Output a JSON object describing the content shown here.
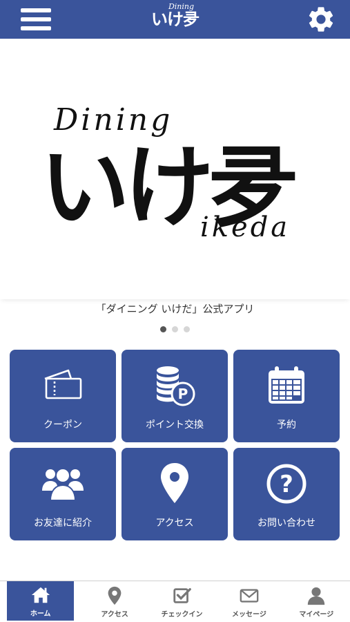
{
  "header": {
    "logo_small": "Dining",
    "logo_big": "いけ夛",
    "menu_icon": "hamburger-icon",
    "settings_icon": "gear-icon"
  },
  "hero": {
    "dining": "Dining",
    "main": "いけ夛",
    "ikeda": "ikeda"
  },
  "caption": "「ダイニング いけだ」公式アプリ",
  "carousel": {
    "count": 3,
    "active": 0
  },
  "menu": [
    {
      "label": "クーポン",
      "icon": "ticket-icon"
    },
    {
      "label": "ポイント交換",
      "icon": "coins-icon"
    },
    {
      "label": "予約",
      "icon": "calendar-icon"
    },
    {
      "label": "お友達に紹介",
      "icon": "users-icon"
    },
    {
      "label": "アクセス",
      "icon": "map-pin-icon"
    },
    {
      "label": "お問い合わせ",
      "icon": "question-icon"
    }
  ],
  "tabbar": [
    {
      "label": "ホーム",
      "icon": "home-icon",
      "active": true
    },
    {
      "label": "アクセス",
      "icon": "map-pin-icon",
      "active": false
    },
    {
      "label": "チェックイン",
      "icon": "checkin-icon",
      "active": false
    },
    {
      "label": "メッセージ",
      "icon": "envelope-icon",
      "active": false
    },
    {
      "label": "マイページ",
      "icon": "user-icon",
      "active": false
    }
  ],
  "colors": {
    "brand": "#3a549b",
    "white": "#ffffff",
    "tab_inactive": "#777777"
  }
}
